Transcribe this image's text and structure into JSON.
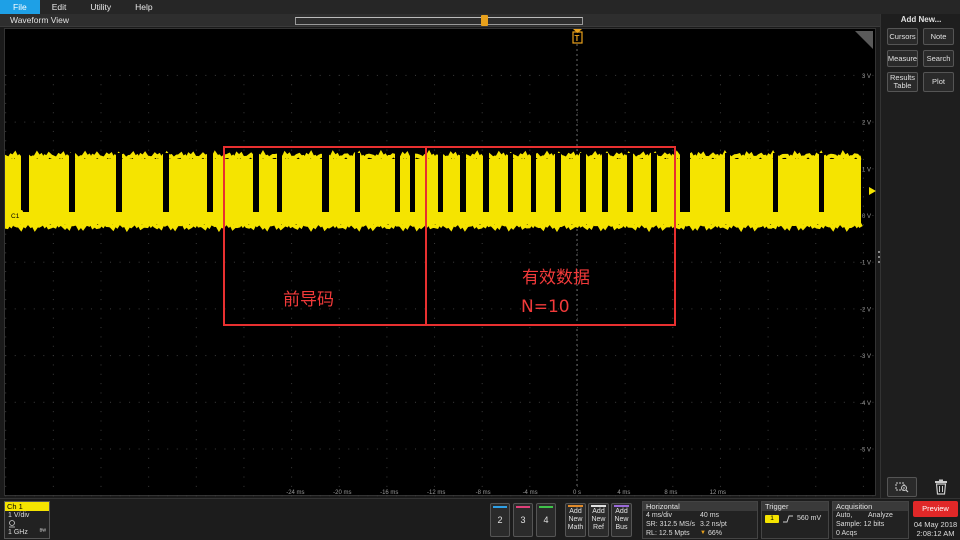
{
  "menu": {
    "items": [
      "File",
      "Edit",
      "Utility",
      "Help"
    ]
  },
  "waveform_view": {
    "title": "Waveform View",
    "channel_marker": "C1",
    "trigger_marker": "T",
    "y_ticks": [
      "3 V",
      "2 V",
      "1 V",
      "0 V",
      "-1 V",
      "-2 V",
      "-3 V",
      "-4 V",
      "-5 V"
    ],
    "x_ticks": [
      "-24 ms",
      "-20 ms",
      "-16 ms",
      "-12 ms",
      "-8 ms",
      "-4 ms",
      "0 s",
      "4 ms",
      "8 ms",
      "12 ms"
    ],
    "annotations": {
      "preamble": "前导码",
      "payload": "有效数据",
      "payload_count": "N=10"
    },
    "colors": {
      "signal": "#f5e400",
      "annotation": "#e83030",
      "trigger": "#e8a11c"
    }
  },
  "right_panel": {
    "title": "Add New...",
    "buttons": [
      "Cursors",
      "Note",
      "Measure",
      "Search",
      "Results Table",
      "Plot"
    ]
  },
  "bottom_bar": {
    "ch1": {
      "label": "Ch 1",
      "scale": "1 V/div",
      "bandwidth": "1 GHz"
    },
    "channel_buttons": [
      "2",
      "3",
      "4"
    ],
    "new_buttons": [
      {
        "line1": "Add",
        "line2": "New",
        "line3": "Math"
      },
      {
        "line1": "Add",
        "line2": "New",
        "line3": "Ref"
      },
      {
        "line1": "Add",
        "line2": "New",
        "line3": "Bus"
      }
    ],
    "horizontal": {
      "title": "Horizontal",
      "row1a": "4 ms/div",
      "row1b": "40 ms",
      "row2a": "SR: 312.5 MS/s",
      "row2b": "3.2 ns/pt",
      "row3a": "RL: 12.5 Mpts",
      "row3b": "66%"
    },
    "trigger": {
      "title": "Trigger",
      "source": "1",
      "level": "560 mV"
    },
    "acquisition": {
      "title": "Acquisition",
      "row1a": "Auto,",
      "row1b": "Analyze",
      "row2": "Sample: 12 bits",
      "row3": "0 Acqs"
    },
    "preview": "Preview",
    "date": "04 May 2018",
    "time": "2:08:12 AM"
  }
}
